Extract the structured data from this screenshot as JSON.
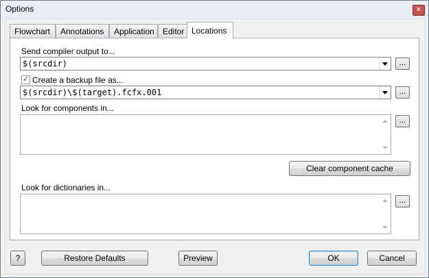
{
  "window": {
    "title": "Options"
  },
  "tabs": [
    "Flowchart",
    "Annotations",
    "Application",
    "Editor",
    "Locations"
  ],
  "active_tab": "Locations",
  "locations": {
    "compiler_output_label": "Send compiler output to...",
    "compiler_output_value": "$(srcdir)",
    "backup_checkbox_label": "Create a backup file as...",
    "backup_checked": true,
    "backup_value": "$(srcdir)\\$(target).fcfx.001",
    "components_label": "Look for components in...",
    "clear_cache_label": "Clear component cache",
    "dictionaries_label": "Look for dictionaries in...",
    "browse_label": "..."
  },
  "buttons": {
    "help": "?",
    "restore_defaults": "Restore Defaults",
    "preview": "Preview",
    "ok": "OK",
    "cancel": "Cancel"
  },
  "glyphs": {
    "close": "✕",
    "check": "✓"
  }
}
